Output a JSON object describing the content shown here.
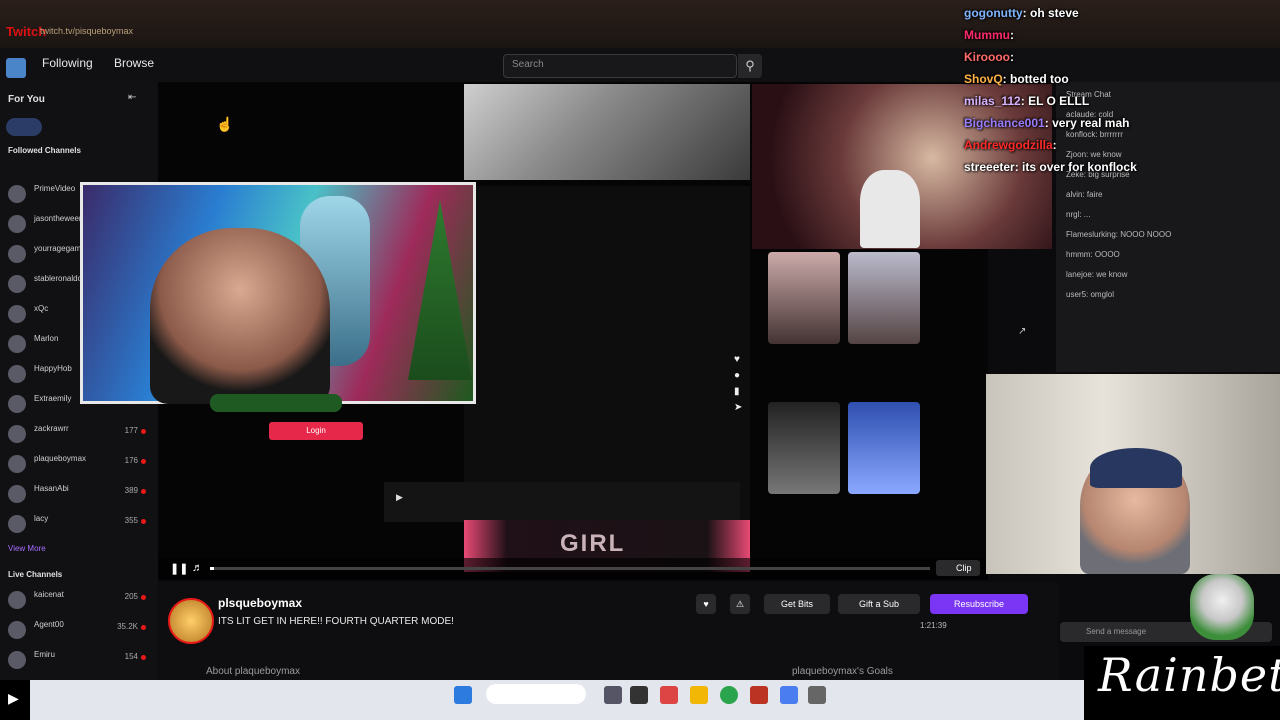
{
  "browser": {
    "tab_title": "Twitch",
    "url": "twitch.tv/pisqueboymax"
  },
  "nav": {
    "following": "Following",
    "browse": "Browse",
    "search_placeholder": "Search",
    "search_icon": "search-icon"
  },
  "sidebar": {
    "for_you": "For You",
    "followed": "Followed Channels",
    "channels": [
      {
        "name": "PrimeVideo",
        "viewers": ""
      },
      {
        "name": "jasontheween",
        "viewers": ""
      },
      {
        "name": "yourragegaming",
        "viewers": ""
      },
      {
        "name": "stableronaldo",
        "viewers": ""
      },
      {
        "name": "xQc",
        "viewers": ""
      },
      {
        "name": "Marlon",
        "viewers": ""
      },
      {
        "name": "HappyHob",
        "viewers": ""
      },
      {
        "name": "Extraemily",
        "viewers": ""
      },
      {
        "name": "zackrawrr",
        "viewers": "177"
      },
      {
        "name": "plaqueboymax",
        "viewers": "176"
      },
      {
        "name": "HasanAbi",
        "viewers": "389"
      },
      {
        "name": "lacy",
        "viewers": "355"
      }
    ],
    "view_more": "View More",
    "live_channels": "Live Channels",
    "live": [
      {
        "name": "kaicenat",
        "viewers": "205"
      },
      {
        "name": "Agent00",
        "viewers": "35.2K"
      },
      {
        "name": "Emiru",
        "viewers": "154"
      }
    ]
  },
  "overlay": {
    "banner_text": "GIRL",
    "button": "Login"
  },
  "channel": {
    "name": "plsqueboymax",
    "title": "ITS LIT GET IN HERE!! FOURTH QUARTER MODE!",
    "about": "About plaqueboymax",
    "about_right": "plaqueboymax's Goals",
    "gift_subs": "Gift a Sub",
    "get_bits": "Get Bits",
    "subscribe": "Resubscribe",
    "clip": "Clip",
    "timestamp": "1:21:39"
  },
  "chat_overlay": [
    {
      "user": "gogonutty",
      "msg": "oh steve",
      "color": "#7fb4ff"
    },
    {
      "user": "Mummu",
      "msg": "",
      "color": "#ff2a6d"
    },
    {
      "user": "Kiroooo",
      "msg": "",
      "color": "#ff6b6b"
    },
    {
      "user": "ShovQ",
      "msg": "botted too",
      "color": "#ffb347"
    },
    {
      "user": "milas_112",
      "msg": "EL O ELLL",
      "color": "#d8b3ff"
    },
    {
      "user": "Bigchance001",
      "msg": "very real mah",
      "color": "#9a7dff"
    },
    {
      "user": "Andrewgodzilla",
      "msg": "",
      "color": "#ff2a2a"
    },
    {
      "user": "streeeter",
      "msg": "its over for konflock",
      "color": "#ffffff"
    }
  ],
  "chat_small": [
    "Stream Chat",
    "aclaude: cold",
    "konflock: brrrrrrr",
    "Zjoon: we know",
    "Zeke: big surprise",
    "alvin: faire",
    "nrgl: ...",
    "Flameslurking: NOOO NOOO",
    "hmmm: OOOO",
    "lanejoe: we know",
    "user5: omglol",
    "Send a message"
  ],
  "watermark": {
    "brand": "Rainbet"
  }
}
